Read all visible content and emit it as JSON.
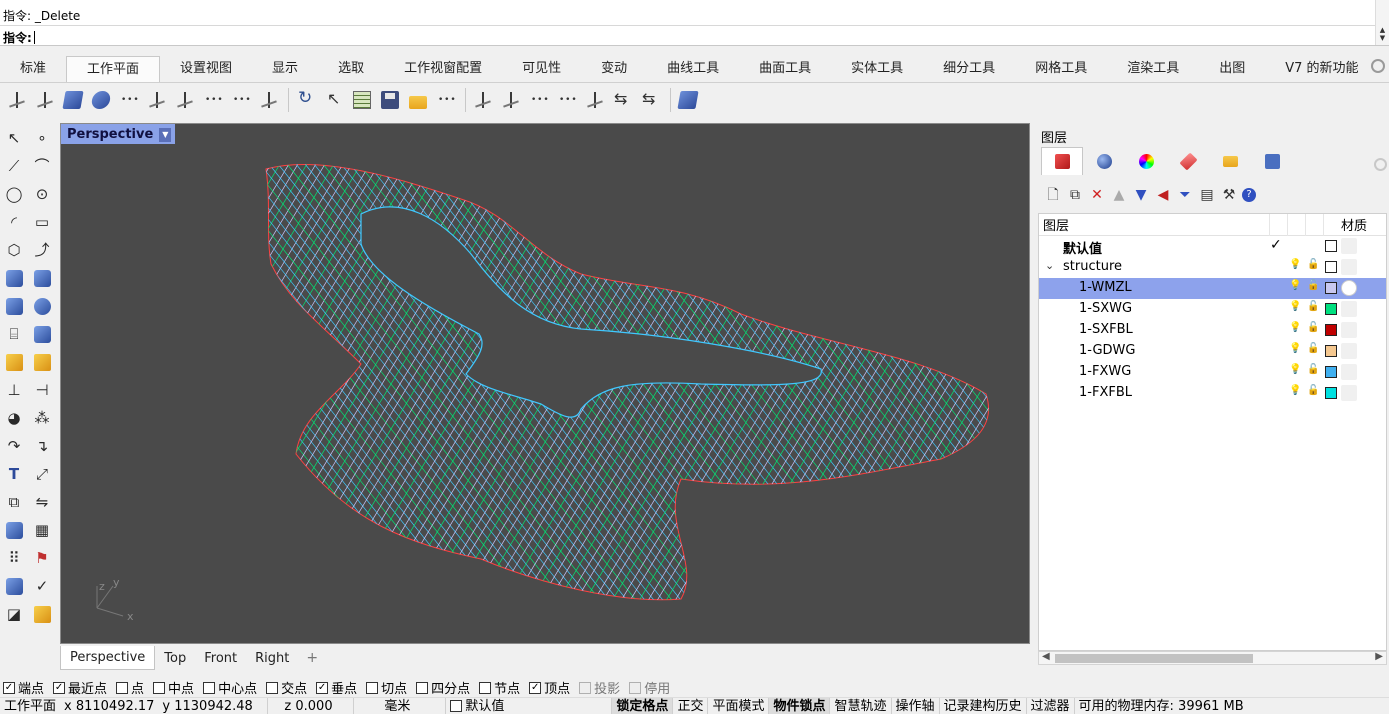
{
  "command": {
    "history": "指令: _Delete",
    "prompt": "指令:"
  },
  "tabs": [
    "标准",
    "工作平面",
    "设置视图",
    "显示",
    "选取",
    "工作视窗配置",
    "可见性",
    "变动",
    "曲线工具",
    "曲面工具",
    "实体工具",
    "细分工具",
    "网格工具",
    "渲染工具",
    "出图",
    "V7 的新功能"
  ],
  "active_tab_index": 1,
  "viewport": {
    "label": "Perspective",
    "background": "#4a4a4a",
    "mesh_colors": [
      "#00e676",
      "#c8c8ff",
      "#40c8ff",
      "#ff4040"
    ],
    "axis": {
      "x": "x",
      "y": "y",
      "z": "z"
    }
  },
  "viewport_tabs": [
    "Perspective",
    "Top",
    "Front",
    "Right"
  ],
  "viewport_plus": "+",
  "layers": {
    "title": "图层",
    "header_name": "图层",
    "header_material": "材质",
    "rows": [
      {
        "name": "默认值",
        "indent": 0,
        "bold": true,
        "current": true,
        "color": "#ffffff",
        "selected": false
      },
      {
        "name": "structure",
        "indent": 0,
        "bold": false,
        "expandable": true,
        "color": "#ffffff",
        "selected": false
      },
      {
        "name": "1-WMZL",
        "indent": 1,
        "color": "#c8c8f0",
        "selected": true
      },
      {
        "name": "1-SXWG",
        "indent": 1,
        "color": "#00e080",
        "selected": false
      },
      {
        "name": "1-SXFBL",
        "indent": 1,
        "color": "#c00000",
        "selected": false
      },
      {
        "name": "1-GDWG",
        "indent": 1,
        "color": "#f5c890",
        "selected": false
      },
      {
        "name": "1-FXWG",
        "indent": 1,
        "color": "#40b0f0",
        "selected": false
      },
      {
        "name": "1-FXFBL",
        "indent": 1,
        "color": "#00e0e0",
        "selected": false
      }
    ]
  },
  "osnaps": [
    {
      "label": "端点",
      "checked": true
    },
    {
      "label": "最近点",
      "checked": true
    },
    {
      "label": "点",
      "checked": false
    },
    {
      "label": "中点",
      "checked": false
    },
    {
      "label": "中心点",
      "checked": false
    },
    {
      "label": "交点",
      "checked": false
    },
    {
      "label": "垂点",
      "checked": true
    },
    {
      "label": "切点",
      "checked": false
    },
    {
      "label": "四分点",
      "checked": false
    },
    {
      "label": "节点",
      "checked": false
    },
    {
      "label": "顶点",
      "checked": true
    },
    {
      "label": "投影",
      "checked": false,
      "disabled": true
    },
    {
      "label": "停用",
      "checked": false,
      "disabled": true
    }
  ],
  "status": {
    "cplane": "工作平面",
    "x": "x 8110492.17",
    "y": "y 1130942.48",
    "z": "z 0.000",
    "units": "毫米",
    "layer": "默认值",
    "grid_snap": "锁定格点",
    "ortho": "正交",
    "planar": "平面模式",
    "osnap": "物件锁点",
    "smarttrack": "智慧轨迹",
    "gumball": "操作轴",
    "history": "记录建构历史",
    "filter": "过滤器",
    "memory": "可用的物理内存: 39961 MB"
  }
}
